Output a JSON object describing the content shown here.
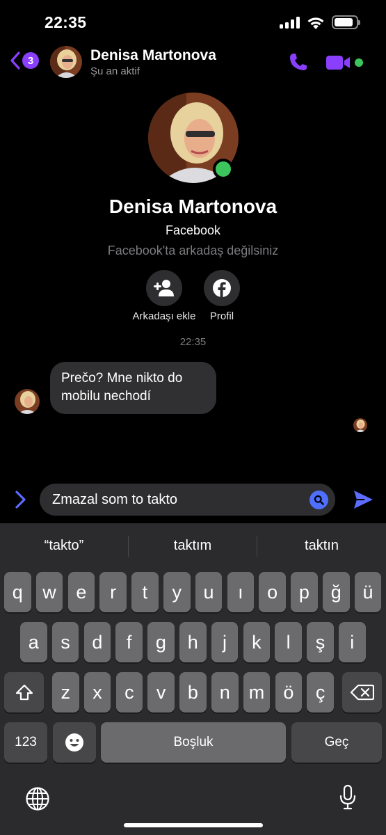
{
  "status_bar": {
    "time": "22:35",
    "battery_level": 0.85
  },
  "header": {
    "back_badge": "3",
    "name": "Denisa Martonova",
    "status": "Şu an aktif",
    "accent_color": "#8a3ffc",
    "online_color": "#3cc55c"
  },
  "profile": {
    "name": "Denisa Martonova",
    "network": "Facebook",
    "note": "Facebook'ta arkadaş değilsiniz",
    "actions": [
      {
        "label": "Arkadaşı ekle",
        "icon": "add-friend-icon"
      },
      {
        "label": "Profil",
        "icon": "facebook-icon"
      }
    ]
  },
  "conversation": {
    "timestamp": "22:35",
    "messages": [
      {
        "sender": "Denisa Martonova",
        "text": "Prečo? Mne nikto do mobilu nechodí"
      }
    ]
  },
  "composer": {
    "value": "Zmazal som to takto"
  },
  "keyboard": {
    "suggestions": [
      "“takto”",
      "taktım",
      "taktın"
    ],
    "row1": [
      "q",
      "w",
      "e",
      "r",
      "t",
      "y",
      "u",
      "ı",
      "o",
      "p",
      "ğ",
      "ü"
    ],
    "row2": [
      "a",
      "s",
      "d",
      "f",
      "g",
      "h",
      "j",
      "k",
      "l",
      "ş",
      "i"
    ],
    "row3": [
      "z",
      "x",
      "c",
      "v",
      "b",
      "n",
      "m",
      "ö",
      "ç"
    ],
    "numbers_label": "123",
    "space_label": "Boşluk",
    "return_label": "Geç"
  }
}
